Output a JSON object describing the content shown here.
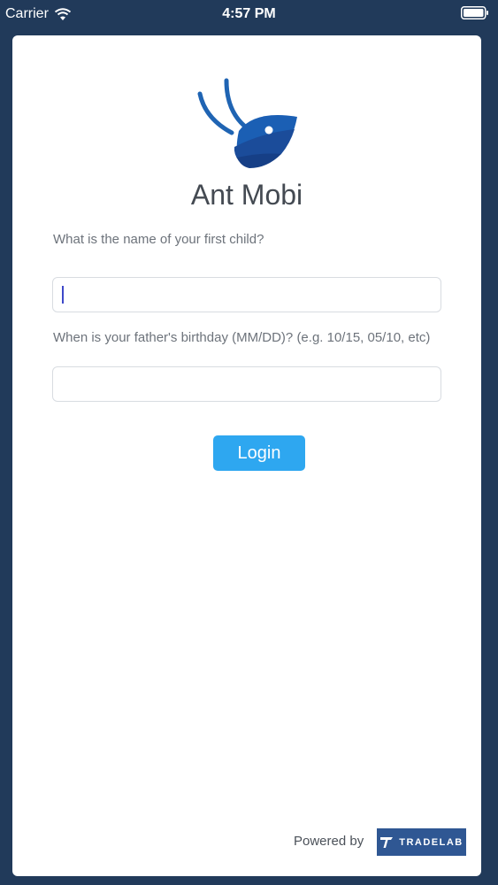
{
  "status_bar": {
    "carrier": "Carrier",
    "time": "4:57 PM",
    "icons": [
      "wifi-icon",
      "battery-icon"
    ]
  },
  "app": {
    "title": "Ant Mobi",
    "logo_icon": "ant-logo-icon"
  },
  "form": {
    "question_1": "What is the name of your first child?",
    "answer_1_value": "",
    "question_2": "When is your father's  birthday (MM/DD)? (e.g. 10/15, 05/10, etc)",
    "answer_2_value": "",
    "login_label": "Login"
  },
  "footer": {
    "powered_by": "Powered by",
    "brand": "TRADELAB"
  },
  "colors": {
    "background": "#213a5a",
    "accent": "#2ea7f0",
    "brand_badge": "#2f5793",
    "caret": "#3e48c9"
  }
}
